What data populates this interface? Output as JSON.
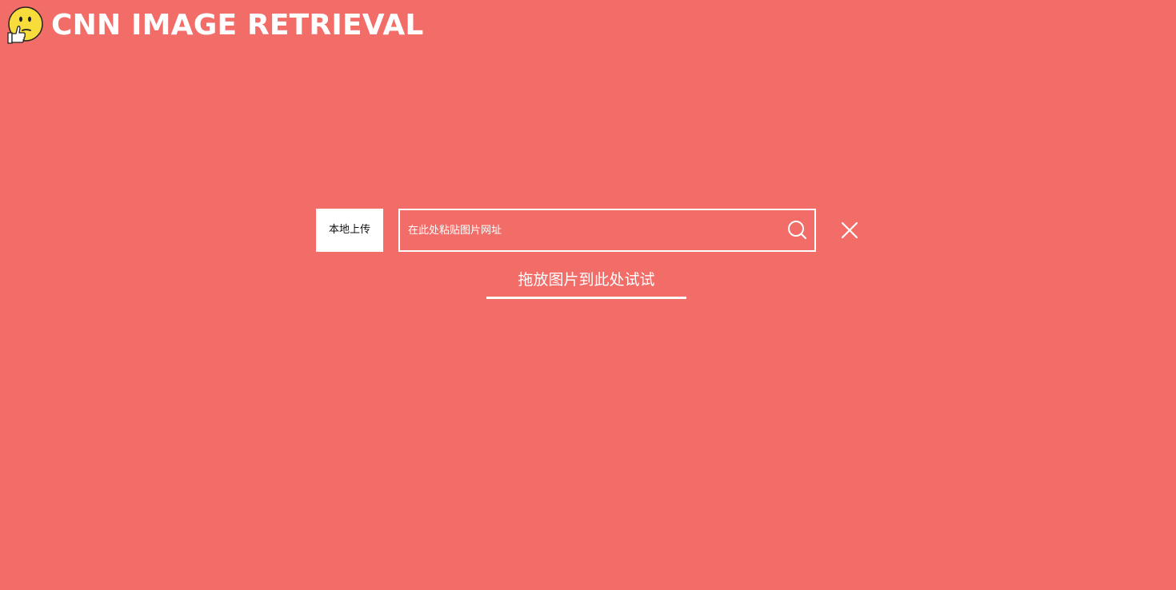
{
  "header": {
    "logo_icon": "thinking-thumbs-up-emoji-icon",
    "title": "CNN IMAGE RETRIEVAL"
  },
  "toolbar": {
    "upload_label": "本地上传",
    "search": {
      "placeholder": "在此处粘贴图片网址",
      "value": "",
      "search_icon": "search-icon"
    },
    "close_icon": "close-icon"
  },
  "drop_zone": {
    "hint": "拖放图片到此处试试"
  },
  "colors": {
    "background": "#f26c68",
    "foreground": "#ffffff",
    "button_bg": "#ffffff",
    "button_text": "#111111",
    "emoji_yellow": "#f7dc3b"
  }
}
